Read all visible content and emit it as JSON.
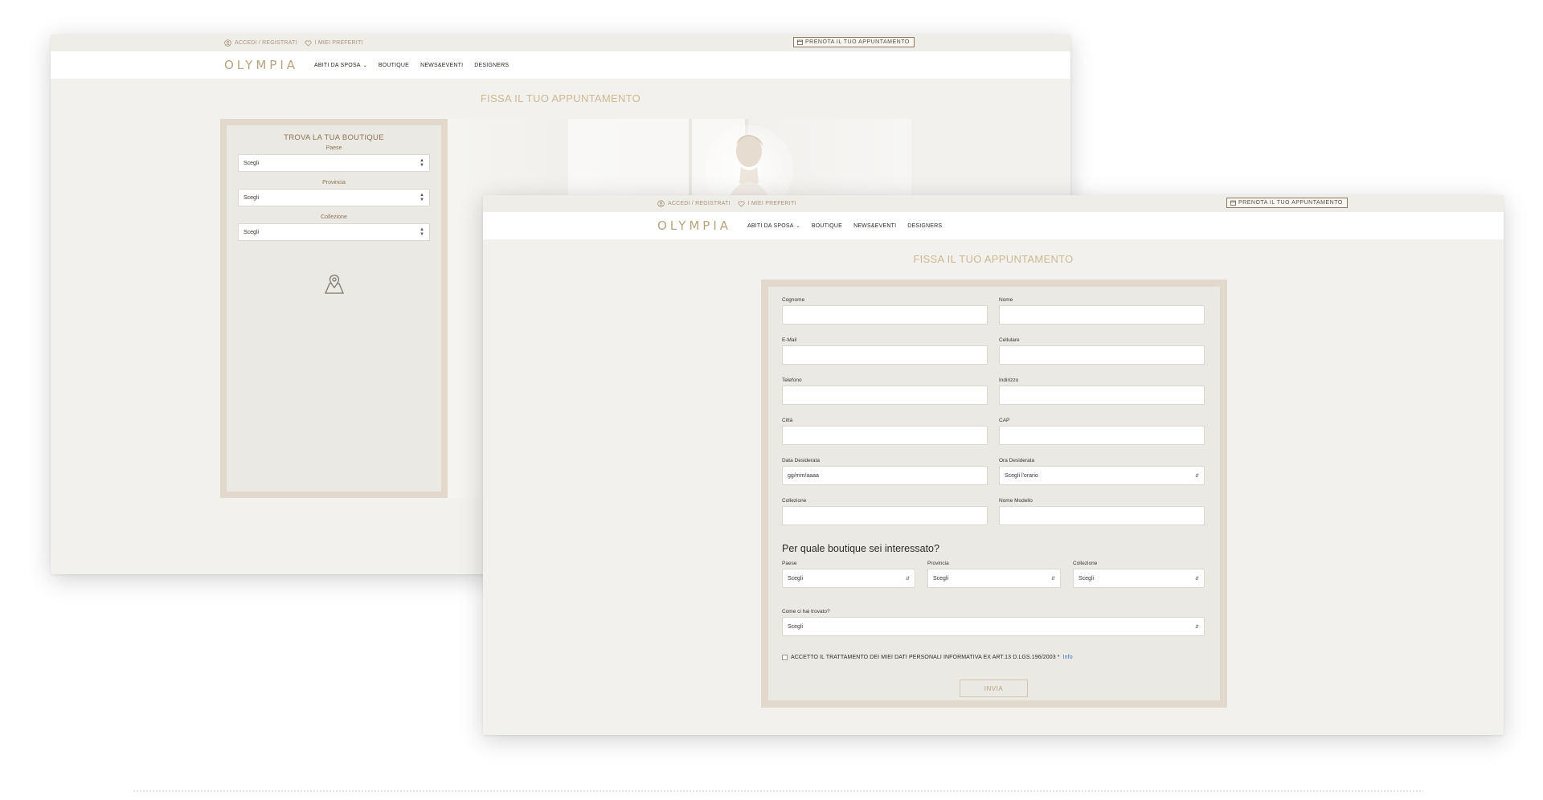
{
  "header": {
    "account_link": "ACCEDI / REGISTRATI",
    "favorites_link": "I MIEI PREFERITI",
    "cta_button": "PRENOTA IL TUO APPUNTAMENTO",
    "logo": "OLYMPIA",
    "menu": [
      "ABITI DA SPOSA",
      "BOUTIQUE",
      "NEWS&EVENTI",
      "DESIGNERS"
    ]
  },
  "page_title": "FISSA IL TUO APPUNTAMENTO",
  "finder": {
    "title": "TROVA LA TUA BOUTIQUE",
    "fields": [
      {
        "label": "Paese",
        "value": "Scegli"
      },
      {
        "label": "Provincia",
        "value": "Scegli"
      },
      {
        "label": "Collezione",
        "value": "Scegli"
      }
    ]
  },
  "form": {
    "fields": [
      {
        "label": "Cognome",
        "value": ""
      },
      {
        "label": "Nome",
        "value": ""
      },
      {
        "label": "E-Mail",
        "value": ""
      },
      {
        "label": "Cellulare",
        "value": ""
      },
      {
        "label": "Telefono",
        "value": ""
      },
      {
        "label": "Indirizzo",
        "value": ""
      },
      {
        "label": "Città",
        "value": ""
      },
      {
        "label": "CAP",
        "value": ""
      },
      {
        "label": "Data Desiderata",
        "value": "gg/mm/aaaa"
      },
      {
        "label": "Ora Desiderata",
        "value": "Scegli l'orario"
      },
      {
        "label": "Collezione",
        "value": ""
      },
      {
        "label": "Nome Modello",
        "value": ""
      }
    ],
    "boutique_title": "Per quale boutique sei interessato?",
    "boutique_fields": [
      {
        "label": "Paese",
        "value": "Scegli"
      },
      {
        "label": "Provincia",
        "value": "Scegli"
      },
      {
        "label": "Collezione",
        "value": "Scegli"
      }
    ],
    "found_label": "Come ci hai trovato?",
    "found_value": "Scegli",
    "consent_text": "ACCETTO IL TRATTAMENTO DEI MIEI DATI PERSONALI INFORMATIVA EX ART.13 D.LGS.196/2003 *",
    "consent_link": "Info",
    "submit": "INVIA"
  },
  "colors": {
    "accent_gold": "#b8a37e",
    "page_bg": "#f2f1ee",
    "panel_border": "#e0d9cc",
    "link_blue": "#3f76b8"
  }
}
